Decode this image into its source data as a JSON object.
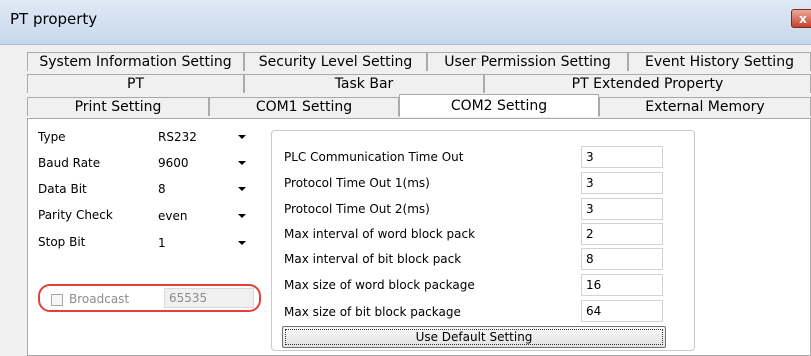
{
  "window": {
    "title": "PT property",
    "close_glyph": "x"
  },
  "tabs": {
    "row1": [
      "System Information Setting",
      "Security Level Setting",
      "User Permission Setting",
      "Event History Setting"
    ],
    "row2": [
      "PT",
      "Task Bar",
      "PT Extended Property"
    ],
    "row3": [
      "Print Setting",
      "COM1 Setting",
      "COM2 Setting",
      "External Memory"
    ],
    "selected": "COM2 Setting"
  },
  "serial": {
    "type": {
      "label": "Type",
      "value": "RS232"
    },
    "baud_rate": {
      "label": "Baud Rate",
      "value": "9600"
    },
    "data_bit": {
      "label": "Data Bit",
      "value": "8"
    },
    "parity_check": {
      "label": "Parity Check",
      "value": "even"
    },
    "stop_bit": {
      "label": "Stop Bit",
      "value": "1"
    }
  },
  "broadcast": {
    "label": "Broadcast",
    "value": "65535",
    "checked": false,
    "enabled": false
  },
  "plc": {
    "rows": [
      {
        "label": "PLC Communication Time Out",
        "value": "3"
      },
      {
        "label": "Protocol Time Out 1(ms)",
        "value": "3"
      },
      {
        "label": "Protocol Time Out 2(ms)",
        "value": "3"
      },
      {
        "label": "Max interval of word block pack",
        "value": "2"
      },
      {
        "label": "Max interval of bit block pack",
        "value": "8"
      },
      {
        "label": "Max size of word block package",
        "value": "16"
      },
      {
        "label": "Max size of bit block package",
        "value": "64"
      }
    ],
    "default_button_label": "Use Default Setting"
  },
  "colors": {
    "highlight_outline": "#e0413a",
    "close_button": "#c7412c"
  }
}
